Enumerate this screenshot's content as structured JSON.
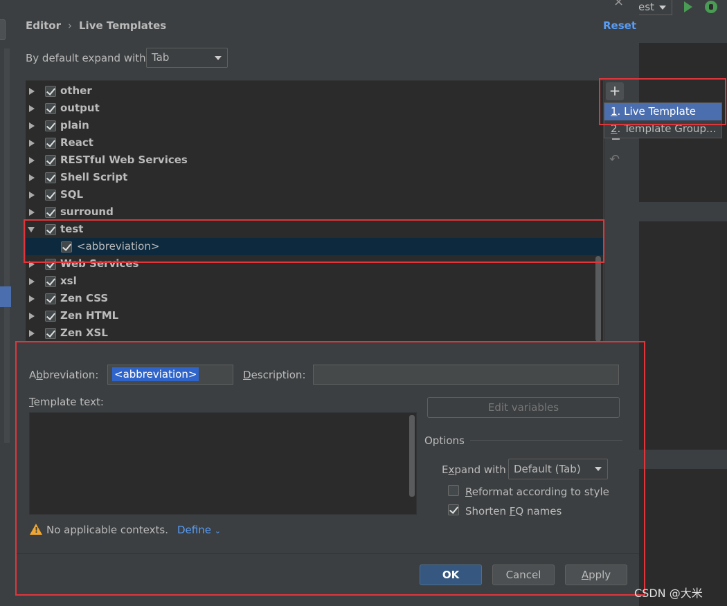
{
  "background": {
    "run_config": "est",
    "watermark": "CSDN @大米"
  },
  "header": {
    "breadcrumb_parent": "Editor",
    "breadcrumb_separator": "›",
    "breadcrumb_current": "Live Templates",
    "reset": "Reset"
  },
  "expand": {
    "label": "By default expand with",
    "value": "Tab"
  },
  "tree": {
    "groups": [
      {
        "label": "other",
        "checked": true
      },
      {
        "label": "output",
        "checked": true
      },
      {
        "label": "plain",
        "checked": true
      },
      {
        "label": "React",
        "checked": true
      },
      {
        "label": "RESTful Web Services",
        "checked": true
      },
      {
        "label": "Shell Script",
        "checked": true
      },
      {
        "label": "SQL",
        "checked": true
      },
      {
        "label": "surround",
        "checked": true
      },
      {
        "label": "test",
        "checked": true,
        "expanded": true
      },
      {
        "label": "<abbreviation>",
        "checked": true,
        "child": true,
        "selected": true
      },
      {
        "label": "Web Services",
        "checked": true
      },
      {
        "label": "xsl",
        "checked": true
      },
      {
        "label": "Zen CSS",
        "checked": true
      },
      {
        "label": "Zen HTML",
        "checked": true
      },
      {
        "label": "Zen XSL",
        "checked": true
      }
    ]
  },
  "toolbar": {
    "add": "+",
    "remove": "−",
    "undo": "↶"
  },
  "popup": {
    "items": [
      {
        "mnemonic": "1",
        "label": ". Live Template"
      },
      {
        "mnemonic": "2",
        "label": ". Template Group..."
      }
    ]
  },
  "editor": {
    "abbr_label_a": "A",
    "abbr_label_mn": "b",
    "abbr_label_rest": "breviation:",
    "abbr_value": "<abbreviation>",
    "desc_label_mn": "D",
    "desc_label_rest": "escription:",
    "desc_value": "",
    "template_label_mn": "T",
    "template_label_rest": "emplate text:",
    "edit_variables": "Edit variables",
    "options_title": "Options",
    "expand_with_a": "E",
    "expand_with_mn": "x",
    "expand_with_rest": "pand with",
    "expand_with_value": "Default (Tab)",
    "reformat_mn": "R",
    "reformat_rest": "eformat according to style",
    "reformat_checked": false,
    "shorten_a": "Shorten ",
    "shorten_mn": "F",
    "shorten_rest": "Q names",
    "shorten_checked": true,
    "no_contexts": "No applicable contexts.",
    "define": "Define"
  },
  "buttons": {
    "ok": "OK",
    "cancel": "Cancel",
    "apply_mn": "A",
    "apply_rest": "pply"
  },
  "colors": {
    "dialog_bg": "#3c3f41",
    "accent_link": "#589df6",
    "selection": "#4b6eaf",
    "highlight_box": "#e0353b"
  }
}
